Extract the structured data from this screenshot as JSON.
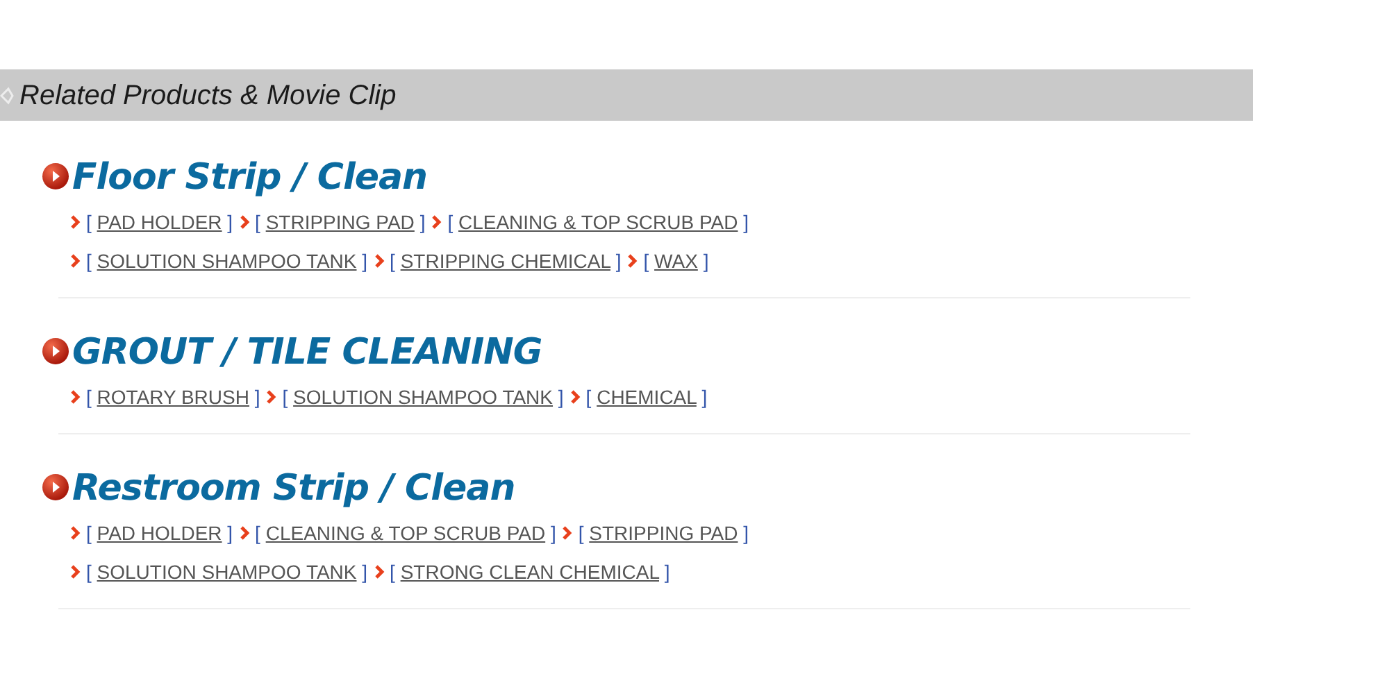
{
  "header": {
    "title": "Related Products & Movie Clip"
  },
  "sections": [
    {
      "title": "Floor Strip / Clean",
      "rows": [
        [
          {
            "open": "[",
            "label": "PAD HOLDER",
            "close": "]"
          },
          {
            "open": "[",
            "label": "STRIPPING PAD",
            "close": "]"
          },
          {
            "open": "[",
            "label": "CLEANING & TOP SCRUB PAD",
            "close": "]"
          }
        ],
        [
          {
            "open": "[",
            "label": "SOLUTION SHAMPOO TANK",
            "close": "]"
          },
          {
            "open": "[",
            "label": "STRIPPING CHEMICAL",
            "close": "]"
          },
          {
            "open": "[",
            "label": "WAX",
            "close": "]"
          }
        ]
      ]
    },
    {
      "title": "GROUT / TILE CLEANING",
      "rows": [
        [
          {
            "open": "[",
            "label": "ROTARY BRUSH",
            "close": "]"
          },
          {
            "open": "[",
            "label": "SOLUTION SHAMPOO TANK",
            "close": "]"
          },
          {
            "open": "[",
            "label": "CHEMICAL",
            "close": "]"
          }
        ]
      ]
    },
    {
      "title": "Restroom Strip / Clean",
      "rows": [
        [
          {
            "open": "[",
            "label": "PAD HOLDER",
            "close": "]"
          },
          {
            "open": "[",
            "label": "CLEANING & TOP SCRUB PAD",
            "close": "]"
          },
          {
            "open": "[",
            "label": "STRIPPING PAD",
            "close": "]"
          }
        ],
        [
          {
            "open": "[",
            "label": "SOLUTION SHAMPOO TANK",
            "close": "]"
          },
          {
            "open": "[",
            "label": "STRONG CLEAN CHEMICAL",
            "close": "]"
          }
        ]
      ]
    }
  ]
}
